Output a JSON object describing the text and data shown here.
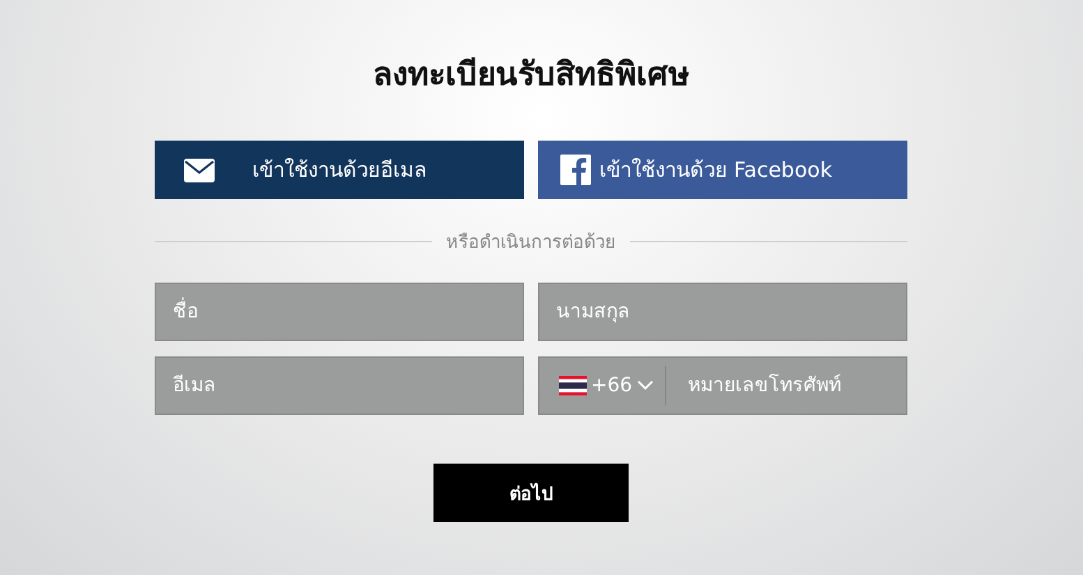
{
  "title": "ลงทะเบียนรับสิทธิพิเศษ",
  "social_buttons": [
    {
      "kind": "email",
      "label": "เข้าใช้งานด้วยอีเมล"
    },
    {
      "kind": "facebook",
      "label": "เข้าใช้งานด้วย Facebook"
    }
  ],
  "divider_text": "หรือดำเนินการต่อด้วย",
  "fields": [
    {
      "kind": "text",
      "placeholder": "ชื่อ"
    },
    {
      "kind": "text",
      "placeholder": "นามสกุล"
    },
    {
      "kind": "text",
      "placeholder": "อีเมล"
    },
    {
      "kind": "phone",
      "country_code": "+66",
      "placeholder": "หมายเลขโทรศัพท์"
    }
  ],
  "submit_button": "ต่อไป"
}
